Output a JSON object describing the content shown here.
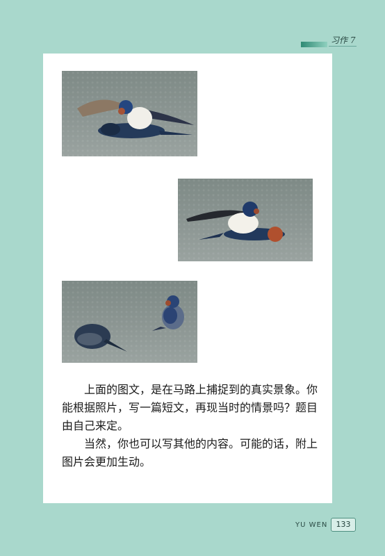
{
  "header": {
    "title": "习作 7"
  },
  "photos": [
    {
      "name": "swallow-photo-1"
    },
    {
      "name": "swallow-photo-2"
    },
    {
      "name": "swallow-photo-3"
    }
  ],
  "text": {
    "paragraph_1": "上面的图文，是在马路上捕捉到的真实景象。你能根据照片，写一篇短文，再现当时的情景吗？题目由自己来定。",
    "paragraph_2": "当然，你也可以写其他的内容。可能的话，附上图片会更加生动。"
  },
  "footer": {
    "label": "YU WEN",
    "page_number": "133"
  },
  "colors": {
    "background": "#a9d8cc",
    "page": "#ffffff"
  }
}
